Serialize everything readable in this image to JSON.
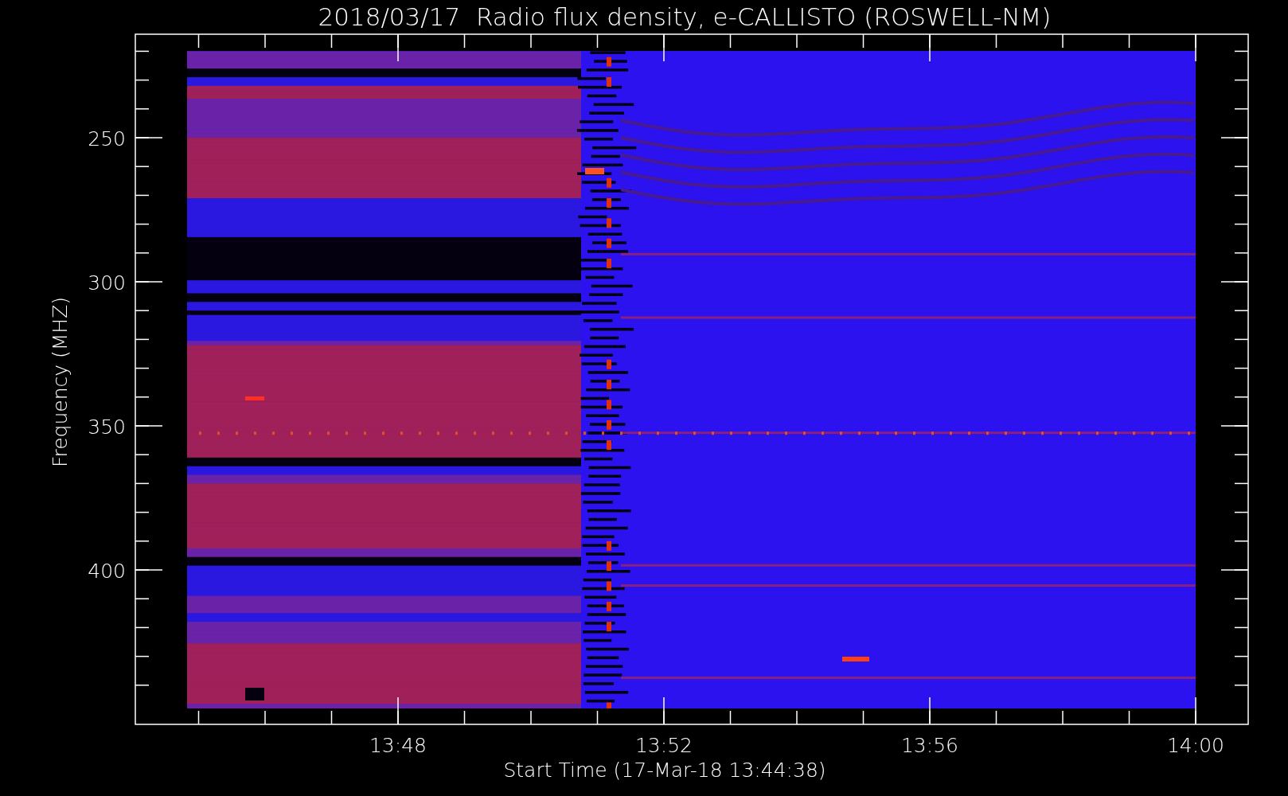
{
  "title": "2018/03/17  Radio flux density, e-CALLISTO (ROSWELL-NM)",
  "y_axis": {
    "label": "Frequency (MHZ)",
    "ticks": [
      "250",
      "300",
      "350",
      "400"
    ]
  },
  "x_axis": {
    "label": "Start Time (17-Mar-18 13:44:38)",
    "ticks": [
      "13:48",
      "13:52",
      "13:56",
      "14:00"
    ]
  }
}
